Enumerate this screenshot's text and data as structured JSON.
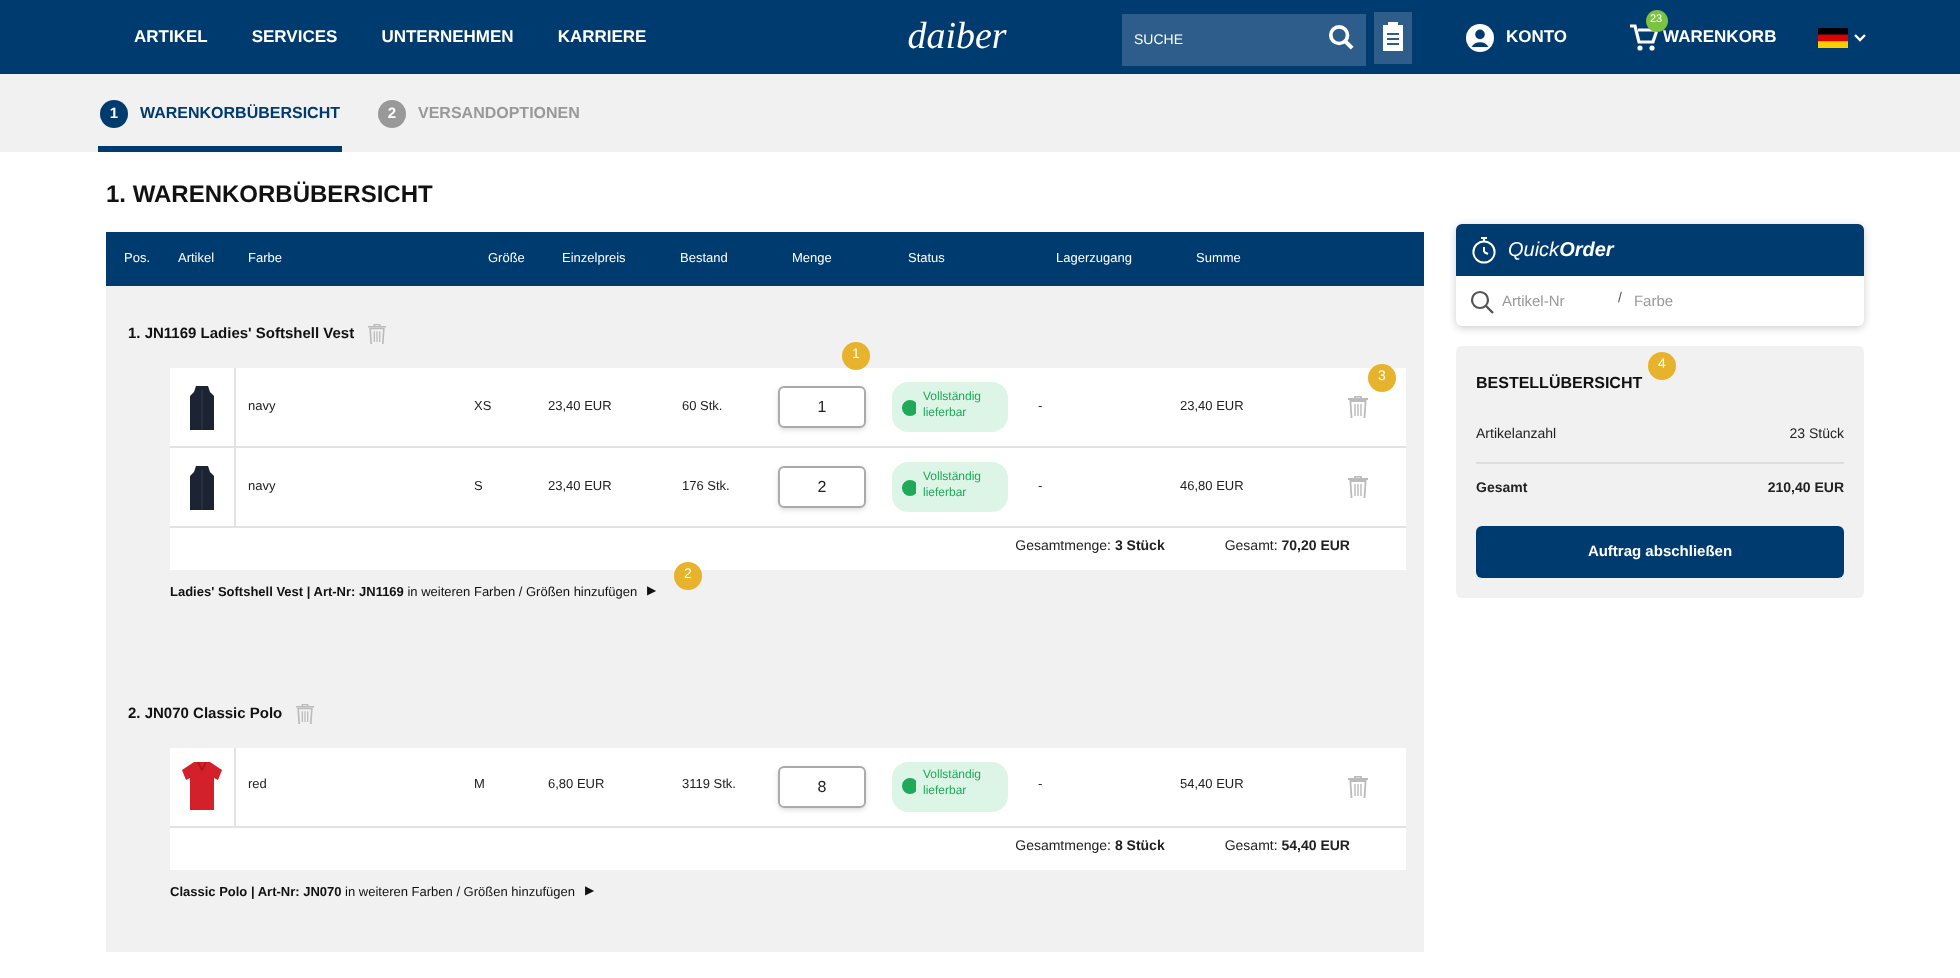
{
  "nav": {
    "links": [
      "ARTIKEL",
      "SERVICES",
      "UNTERNEHMEN",
      "KARRIERE"
    ],
    "logo": "daiber",
    "search": {
      "placeholder": "SUCHE"
    },
    "account": "KONTO",
    "cart": {
      "label": "WARENKORB",
      "count": "23"
    }
  },
  "steps": [
    {
      "number": "1",
      "label": "WARENKORBÜBERSICHT",
      "selected": true
    },
    {
      "number": "2",
      "label": "VERSANDOPTIONEN",
      "selected": false
    }
  ],
  "page_title": "1. WARENKORBÜBERSICHT",
  "table": {
    "columns": [
      "Pos.",
      "Artikel",
      "Farbe",
      "Größe",
      "Einzelpreis",
      "Bestand",
      "Menge",
      "Status",
      "Lagerzugang",
      "Summe"
    ],
    "groups": [
      {
        "title": "1. JN1169 Ladies' Softshell Vest",
        "kind": "vest",
        "rows": [
          {
            "color_name": "navy",
            "size": "XS",
            "price": "23,40 EUR",
            "stock": "60 Stk.",
            "quantity": "1",
            "status": "Vollständig lieferbar",
            "incoming": "-",
            "sum": "23,40 EUR"
          },
          {
            "color_name": "navy",
            "size": "S",
            "price": "23,40 EUR",
            "stock": "176 Stk.",
            "quantity": "2",
            "status": "Vollständig lieferbar",
            "incoming": "-",
            "sum": "46,80 EUR"
          }
        ],
        "total_quantity": "Gesamtmenge: **3 Stück**",
        "total": "Gesamt: **70,20 EUR**",
        "link": "**Ladies' Softshell Vest | Art-Nr: JN1169** in weiteren Farben / Größen hinzufügen",
        "link_arrow": "▶"
      },
      {
        "title": "2. JN070 Classic Polo",
        "kind": "polo",
        "rows": [
          {
            "color_name": "red",
            "size": "M",
            "price": "6,80 EUR",
            "stock": "3119 Stk.",
            "quantity": "8",
            "status": "Vollständig lieferbar",
            "incoming": "-",
            "sum": "54,40 EUR"
          }
        ],
        "total_quantity": "Gesamtmenge: **8 Stück**",
        "total": "Gesamt: **54,40 EUR**",
        "link": "**Classic Polo | Art-Nr: JN070** in weiteren Farben / Größen hinzufügen",
        "link_arrow": "▶"
      }
    ]
  },
  "quick_order": {
    "title": "Quick**Order**",
    "article_placeholder": "Artikel-Nr",
    "separator": "/",
    "color_placeholder": "Farbe"
  },
  "summary": {
    "title": "BESTELLÜBERSICHT",
    "rows": [
      {
        "label": "Artikelanzahl",
        "value": "23 Stück",
        "bold": false
      },
      {
        "label": "Gesamt",
        "value": "210,40 EUR",
        "bold": true
      }
    ],
    "button": "Auftrag abschließen"
  },
  "callouts": [
    "1",
    "2",
    "3",
    "4"
  ]
}
